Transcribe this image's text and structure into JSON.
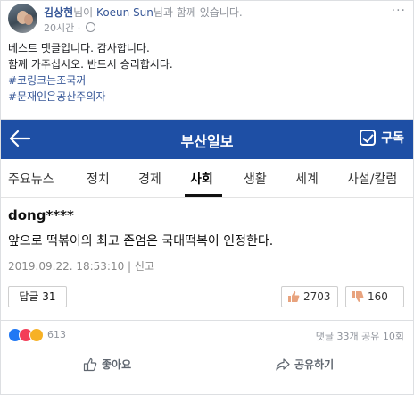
{
  "post": {
    "author": "김상현",
    "joined_text": "님이",
    "with_name": "Koeun Sun",
    "with_suffix": "님과 함께 있습니다.",
    "time": "20시간 ·",
    "more_label": "···",
    "lines": [
      "베스트 댓글입니다. 감사합니다.",
      "함께 가주십시오. 반드시 승리합시다."
    ],
    "hashtags": [
      "#코링크는조국꺼",
      "#문재인은공산주의자"
    ]
  },
  "embed": {
    "paper_name": "부산일보",
    "subscribe_label": "구독",
    "tabs": [
      "주요뉴스",
      "정치",
      "경제",
      "사회",
      "생활",
      "세계",
      "사설/칼럼"
    ],
    "active_tab": "사회",
    "comment": {
      "user": "dong****",
      "text": "앞으로 떡볶이의 최고 존엄은 국대떡복이 인정한다.",
      "date": "2019.09.22. 18:53:10  |  신고",
      "reply_label": "답글 31",
      "likes": "2703",
      "dislikes": "160"
    },
    "colors": {
      "header_bg": "#1e4fa5"
    }
  },
  "stats": {
    "reaction_count": "613",
    "comments_shares": "댓글 33개  공유 10회"
  },
  "actions": {
    "like_label": "좋아요",
    "share_label": "공유하기"
  }
}
